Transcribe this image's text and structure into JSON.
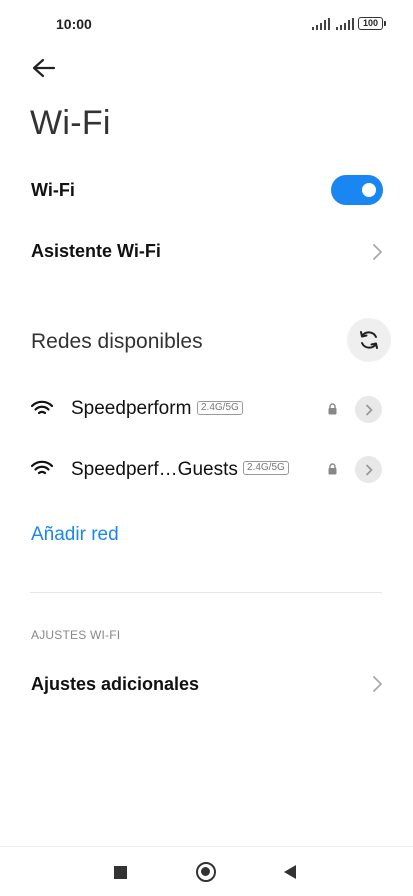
{
  "status_bar": {
    "time": "10:00",
    "battery": "100"
  },
  "header": {
    "title": "Wi-Fi",
    "back_icon": "arrow-left-icon"
  },
  "wifi_toggle": {
    "label": "Wi-Fi",
    "enabled": true,
    "accent": "#1a86f2"
  },
  "assistant": {
    "label": "Asistente Wi-Fi"
  },
  "available": {
    "title": "Redes disponibles",
    "refresh_icon": "refresh-icon",
    "networks": [
      {
        "name": "Speedperform",
        "band": "2.4G/5G",
        "secured": true
      },
      {
        "name": "Speedperf…Guests",
        "band": "2.4G/5G",
        "secured": true
      }
    ],
    "add_network": "Añadir red"
  },
  "settings": {
    "caption": "AJUSTES WI-FI",
    "additional": "Ajustes adicionales"
  }
}
